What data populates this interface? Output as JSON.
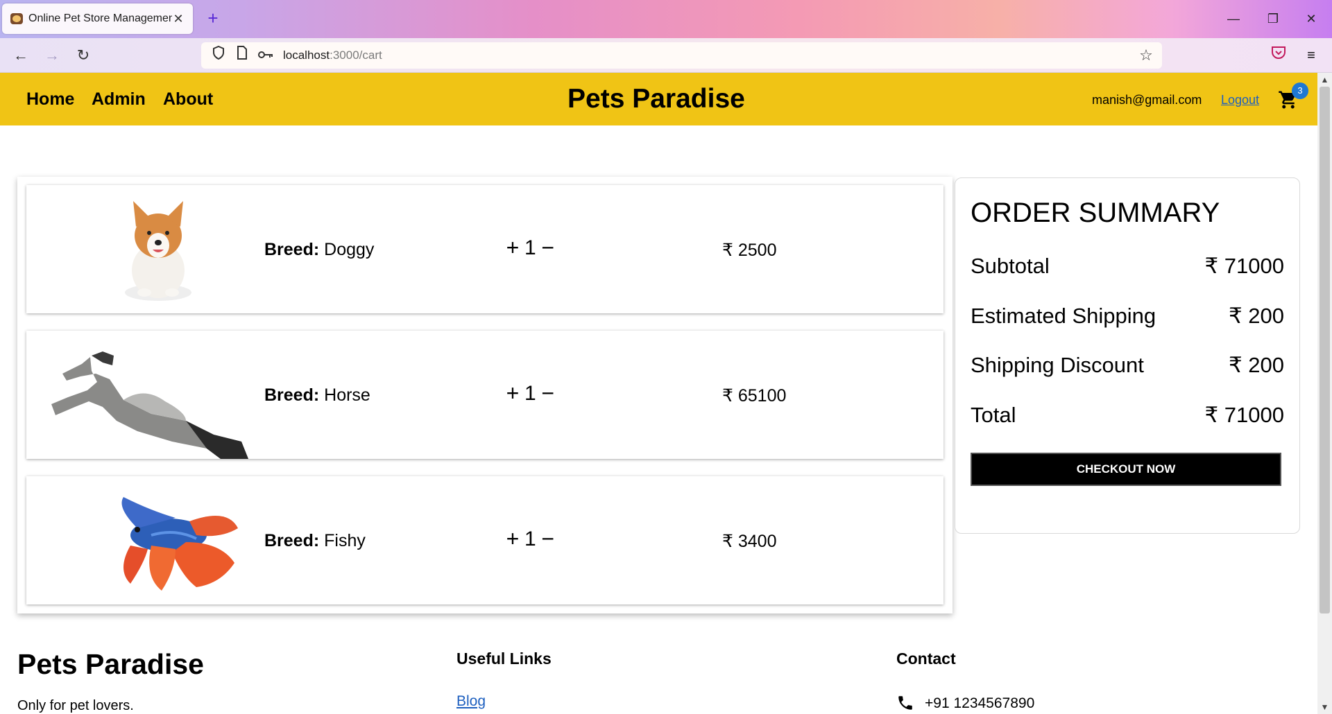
{
  "browser": {
    "tab_title": "Online Pet Store Management",
    "url_host": "localhost",
    "url_path": ":3000/cart"
  },
  "header": {
    "nav": [
      "Home",
      "Admin",
      "About"
    ],
    "brand": "Pets Paradise",
    "user_email": "manish@gmail.com",
    "logout_label": "Logout",
    "cart_count": "3"
  },
  "cart": {
    "breed_label": "Breed:",
    "items": [
      {
        "breed": "Doggy",
        "plus": "+",
        "quantity": "1",
        "minus": "−",
        "price": "₹ 2500",
        "image": "corgi-dog"
      },
      {
        "breed": "Horse",
        "plus": "+",
        "quantity": "1",
        "minus": "−",
        "price": "₹ 65100",
        "image": "rearing-horse"
      },
      {
        "breed": "Fishy",
        "plus": "+",
        "quantity": "1",
        "minus": "−",
        "price": "₹ 3400",
        "image": "betta-fish"
      }
    ]
  },
  "summary": {
    "title": "ORDER SUMMARY",
    "rows": [
      {
        "label": "Subtotal",
        "value": "₹ 71000"
      },
      {
        "label": "Estimated Shipping",
        "value": "₹ 200"
      },
      {
        "label": "Shipping Discount",
        "value": "₹ 200"
      },
      {
        "label": "Total",
        "value": "₹ 71000"
      }
    ],
    "checkout_label": "CHECKOUT NOW"
  },
  "footer": {
    "brand": "Pets Paradise",
    "tagline": "Only for pet lovers.",
    "links_heading": "Useful Links",
    "blog_link": "Blog",
    "contact_heading": "Contact",
    "phone": "+91 1234567890"
  },
  "colors": {
    "header_bg": "#f0c415",
    "badge": "#1e78d2",
    "link": "#1d5fbf",
    "checkout_bg": "#000000"
  }
}
